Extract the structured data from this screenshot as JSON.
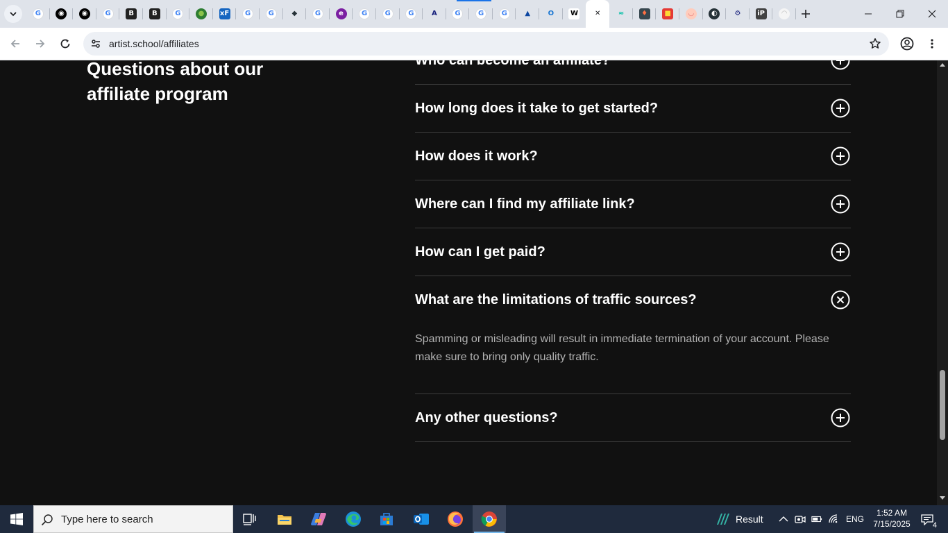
{
  "browser": {
    "tabs": [
      {
        "icon": "google-g-icon",
        "color": "#ffffff"
      },
      {
        "icon": "openai-icon",
        "color": "#000000"
      },
      {
        "icon": "openai-icon",
        "color": "#000000"
      },
      {
        "icon": "google-g-icon",
        "color": "#ffffff"
      },
      {
        "icon": "b-logo-icon",
        "color": "#222222"
      },
      {
        "icon": "b-logo-icon",
        "color": "#222222"
      },
      {
        "icon": "google-g-icon",
        "color": "#ffffff"
      },
      {
        "icon": "globe-green-icon",
        "color": "#2e7d32"
      },
      {
        "icon": "xf-logo-icon",
        "color": "#1565c0"
      },
      {
        "icon": "google-g-icon",
        "color": "#ffffff"
      },
      {
        "icon": "google-g-icon",
        "color": "#ffffff"
      },
      {
        "icon": "layers-icon",
        "color": "#263238"
      },
      {
        "icon": "google-g-icon",
        "color": "#ffffff"
      },
      {
        "icon": "e-logo-icon",
        "color": "#7b1fa2"
      },
      {
        "icon": "google-g-icon",
        "color": "#ffffff"
      },
      {
        "icon": "google-g-icon",
        "color": "#ffffff"
      },
      {
        "icon": "google-g-icon",
        "color": "#ffffff"
      },
      {
        "icon": "script-a-icon",
        "color": "#1a237e"
      },
      {
        "icon": "google-g-icon",
        "color": "#ffffff"
      },
      {
        "icon": "google-g-icon",
        "color": "#ffffff"
      },
      {
        "icon": "google-g-icon",
        "color": "#ffffff"
      },
      {
        "icon": "arrow-logo-icon",
        "color": "#0d47a1"
      },
      {
        "icon": "opera-icon",
        "color": "#1976d2"
      },
      {
        "icon": "wikipedia-icon",
        "color": "#ffffff"
      },
      {
        "icon": "close-tab-icon",
        "color": "#ffffff"
      },
      {
        "icon": "wave-logo-icon",
        "color": "#00bfa5"
      },
      {
        "icon": "game-logo-icon",
        "color": "#37474f"
      },
      {
        "icon": "red-badge-icon",
        "color": "#e53935"
      },
      {
        "icon": "bowl-icon",
        "color": "#e57373"
      },
      {
        "icon": "earth-icon",
        "color": "#263238"
      },
      {
        "icon": "gear-badge-icon",
        "color": "#1a237e"
      },
      {
        "icon": "ip-logo-icon",
        "color": "#424242"
      },
      {
        "icon": "cloud-icon",
        "color": "#ffffff"
      }
    ],
    "active_tab_index": 24,
    "url": "artist.school/affiliates"
  },
  "page": {
    "heading": "Questions about our affiliate program",
    "faq": [
      {
        "question": "Who can become an affiliate?",
        "expanded": false
      },
      {
        "question": "How long does it take to get started?",
        "expanded": false
      },
      {
        "question": "How does it work?",
        "expanded": false
      },
      {
        "question": "Where can I find my affiliate link?",
        "expanded": false
      },
      {
        "question": "How can I get paid?",
        "expanded": false
      },
      {
        "question": "What are the limitations of traffic sources?",
        "expanded": true,
        "answer": "Spamming or misleading will result in immediate termination of your account. Please make sure to bring only quality traffic."
      },
      {
        "question": "Any other questions?",
        "expanded": false
      }
    ]
  },
  "taskbar": {
    "search_placeholder": "Type here to search",
    "apps": [
      "task-view-icon",
      "file-explorer-icon",
      "copilot-icon",
      "edge-icon",
      "microsoft-store-icon",
      "outlook-icon",
      "firefox-icon",
      "chrome-icon"
    ],
    "running_app": "chrome-icon",
    "weather_text": "Result",
    "language": "ENG",
    "time": "1:52 AM",
    "date": "7/15/2025",
    "notification_count": "4"
  },
  "colors": {
    "page_background": "#111111",
    "question_text": "#ffffff",
    "answer_text": "#b3b3b3",
    "divider": "#3d3d3d",
    "taskbar": "#1f2a3d"
  }
}
